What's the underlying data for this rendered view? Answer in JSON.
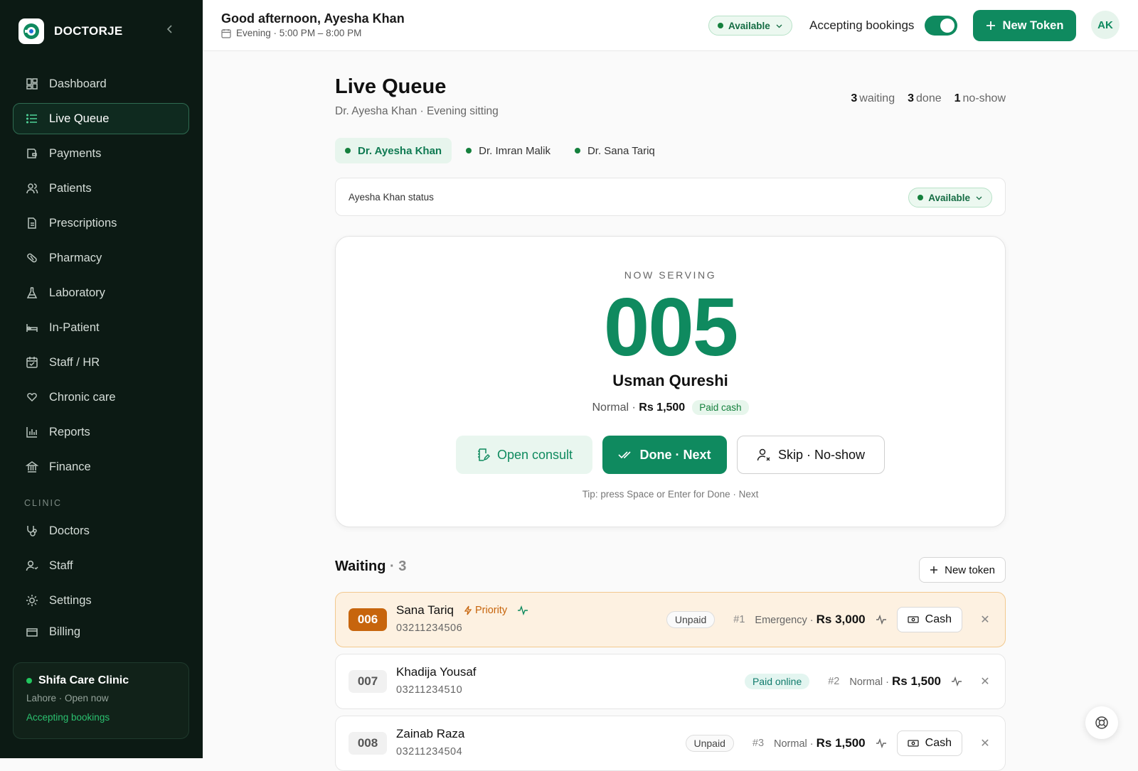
{
  "brand": {
    "name": "DOCTORJE"
  },
  "sidebar": {
    "items": [
      {
        "label": "Dashboard",
        "icon": "dashboard-icon"
      },
      {
        "label": "Live Queue",
        "icon": "list-icon",
        "active": true
      },
      {
        "label": "Payments",
        "icon": "wallet-icon"
      },
      {
        "label": "Patients",
        "icon": "users-icon"
      },
      {
        "label": "Prescriptions",
        "icon": "file-icon"
      },
      {
        "label": "Pharmacy",
        "icon": "pill-icon"
      },
      {
        "label": "Laboratory",
        "icon": "flask-icon"
      },
      {
        "label": "In-Patient",
        "icon": "bed-icon"
      },
      {
        "label": "Staff / HR",
        "icon": "calendar-icon"
      },
      {
        "label": "Chronic care",
        "icon": "heart-hand-icon"
      },
      {
        "label": "Reports",
        "icon": "bar-chart-icon"
      },
      {
        "label": "Finance",
        "icon": "bank-icon"
      }
    ],
    "section_label": "CLINIC",
    "clinic_items": [
      {
        "label": "Doctors",
        "icon": "stethoscope-icon"
      },
      {
        "label": "Staff",
        "icon": "user-icon"
      },
      {
        "label": "Settings",
        "icon": "sun-gear-icon"
      },
      {
        "label": "Billing",
        "icon": "card-icon"
      }
    ],
    "clinic_card": {
      "name": "Shifa Care Clinic",
      "sub": "Lahore · Open now",
      "status": "Accepting bookings"
    }
  },
  "topbar": {
    "greeting": "Good afternoon, Ayesha Khan",
    "shift": "Evening · 5:00 PM – 8:00 PM",
    "availability": "Available",
    "accepting_label": "Accepting bookings",
    "accepting_on": true,
    "new_token_label": "New Token",
    "avatar_initials": "AK"
  },
  "page": {
    "title": "Live Queue",
    "subtitle": "Dr. Ayesha Khan · Evening sitting",
    "stats": {
      "waiting_count": "3",
      "waiting_label": "waiting",
      "done_count": "3",
      "done_label": "done",
      "noshow_count": "1",
      "noshow_label": "no-show"
    },
    "doctors": [
      "Dr. Ayesha Khan",
      "Dr. Imran Malik",
      "Dr. Sana Tariq"
    ],
    "status_label": "Ayesha Khan status",
    "status_value": "Available"
  },
  "serving": {
    "label": "NOW SERVING",
    "token": "005",
    "patient": "Usman Qureshi",
    "type": "Normal",
    "fee": "Rs 1,500",
    "payment": "Paid cash",
    "open_consult": "Open consult",
    "done_next": "Done · Next",
    "skip": "Skip · No-show",
    "tip": "Tip: press Space or Enter for Done · Next"
  },
  "waiting": {
    "title": "Waiting",
    "count": "3",
    "new_token_label": "New token",
    "rows": [
      {
        "token": "006",
        "name": "Sana Tariq",
        "phone": "03211234506",
        "priority": "Priority",
        "payment": "Unpaid",
        "position": "#1",
        "type": "Emergency",
        "fee": "Rs 3,000",
        "cash_label": "Cash"
      },
      {
        "token": "007",
        "name": "Khadija Yousaf",
        "phone": "03211234510",
        "payment": "Paid online",
        "position": "#2",
        "type": "Normal",
        "fee": "Rs 1,500"
      },
      {
        "token": "008",
        "name": "Zainab Raza",
        "phone": "03211234504",
        "payment": "Unpaid",
        "position": "#3",
        "type": "Normal",
        "fee": "Rs 1,500",
        "cash_label": "Cash"
      }
    ]
  },
  "colors": {
    "brand": "#0f8a5f",
    "sidebar_bg": "#0c1a14",
    "priority": "#c7650d"
  }
}
